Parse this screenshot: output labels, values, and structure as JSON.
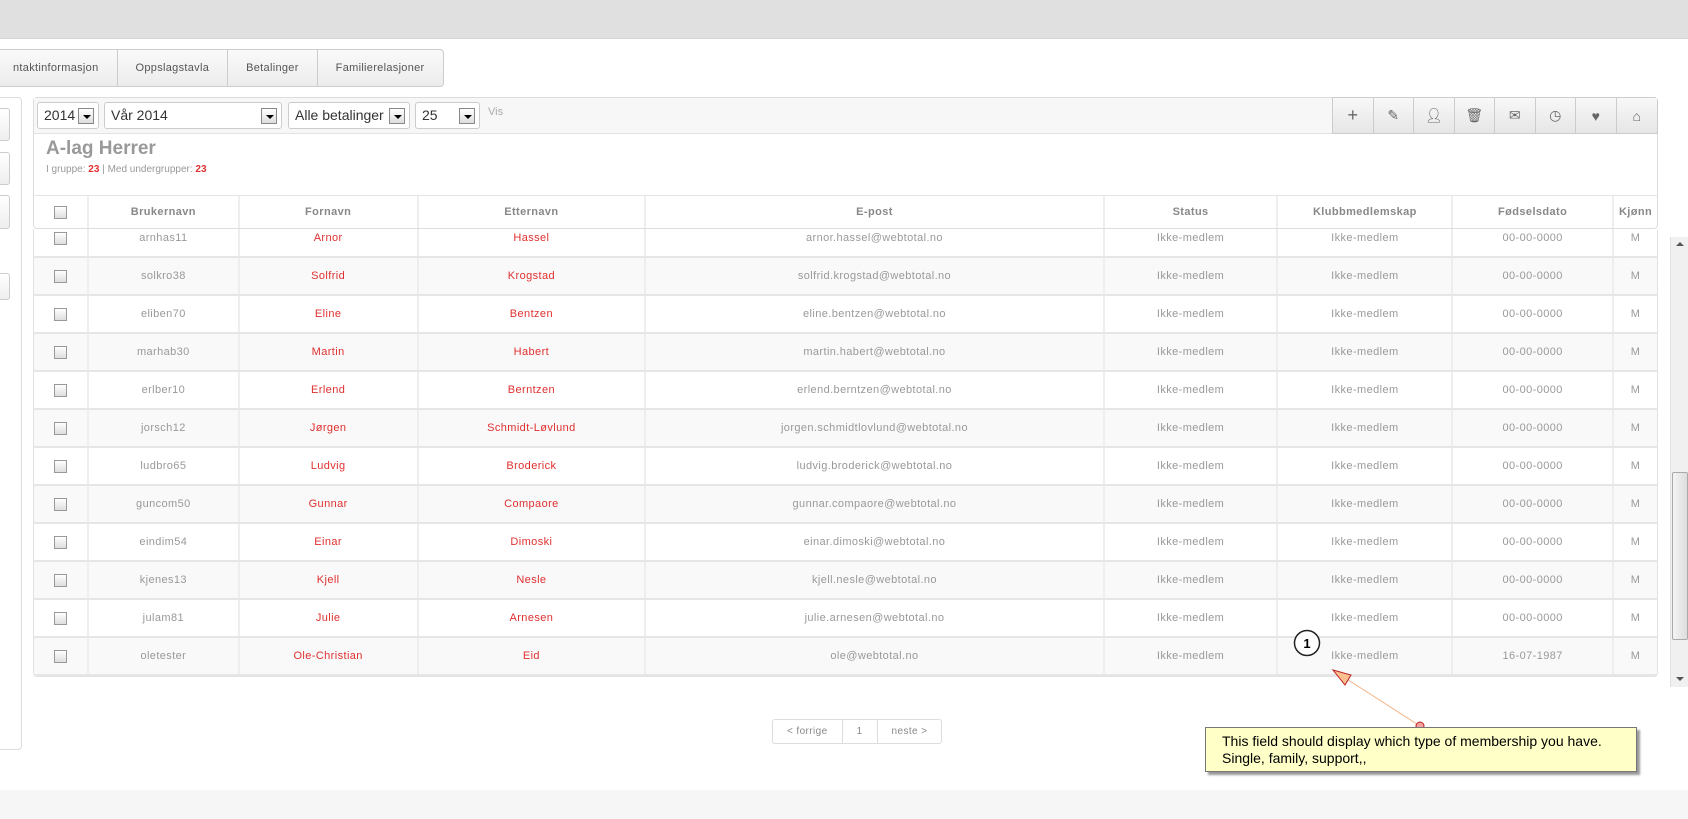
{
  "tabs": [
    "ntaktinformasjon",
    "Oppslagstavla",
    "Betalinger",
    "Familierelasjoner"
  ],
  "filters": {
    "year": "2014",
    "term": "Vår 2014",
    "payments": "Alle betalinger",
    "per_page": "25",
    "show_label": "Vis"
  },
  "toolbar_icons": [
    "plus-icon",
    "pencil-icon",
    "user-icon",
    "trash-icon",
    "mail-icon",
    "clock-icon",
    "heart-icon",
    "home-icon"
  ],
  "group": {
    "title": "A-lag Herrer",
    "in_group_label": "I gruppe:",
    "in_group_count": "23",
    "sep": "|",
    "sub_label": "Med undergrupper:",
    "sub_count": "23"
  },
  "columns": [
    "Brukernavn",
    "Fornavn",
    "Etternavn",
    "E-post",
    "Status",
    "Klubbmedlemskap",
    "Fødselsdato",
    "Kjønn"
  ],
  "rows": [
    [
      "arnhas11",
      "Arnor",
      "Hassel",
      "arnor.hassel@webtotal.no",
      "Ikke-medlem",
      "Ikke-medlem",
      "00-00-0000",
      "M"
    ],
    [
      "solkro38",
      "Solfrid",
      "Krogstad",
      "solfrid.krogstad@webtotal.no",
      "Ikke-medlem",
      "Ikke-medlem",
      "00-00-0000",
      "M"
    ],
    [
      "eliben70",
      "Eline",
      "Bentzen",
      "eline.bentzen@webtotal.no",
      "Ikke-medlem",
      "Ikke-medlem",
      "00-00-0000",
      "M"
    ],
    [
      "marhab30",
      "Martin",
      "Habert",
      "martin.habert@webtotal.no",
      "Ikke-medlem",
      "Ikke-medlem",
      "00-00-0000",
      "M"
    ],
    [
      "erlber10",
      "Erlend",
      "Berntzen",
      "erlend.berntzen@webtotal.no",
      "Ikke-medlem",
      "Ikke-medlem",
      "00-00-0000",
      "M"
    ],
    [
      "jorsch12",
      "Jørgen",
      "Schmidt-Løvlund",
      "jorgen.schmidtlovlund@webtotal.no",
      "Ikke-medlem",
      "Ikke-medlem",
      "00-00-0000",
      "M"
    ],
    [
      "ludbro65",
      "Ludvig",
      "Broderick",
      "ludvig.broderick@webtotal.no",
      "Ikke-medlem",
      "Ikke-medlem",
      "00-00-0000",
      "M"
    ],
    [
      "guncom50",
      "Gunnar",
      "Compaore",
      "gunnar.compaore@webtotal.no",
      "Ikke-medlem",
      "Ikke-medlem",
      "00-00-0000",
      "M"
    ],
    [
      "eindim54",
      "Einar",
      "Dimoski",
      "einar.dimoski@webtotal.no",
      "Ikke-medlem",
      "Ikke-medlem",
      "00-00-0000",
      "M"
    ],
    [
      "kjenes13",
      "Kjell",
      "Nesle",
      "kjell.nesle@webtotal.no",
      "Ikke-medlem",
      "Ikke-medlem",
      "00-00-0000",
      "M"
    ],
    [
      "julam81",
      "Julie",
      "Arnesen",
      "julie.arnesen@webtotal.no",
      "Ikke-medlem",
      "Ikke-medlem",
      "00-00-0000",
      "M"
    ],
    [
      "oletester",
      "Ole-Christian",
      "Eid",
      "ole@webtotal.no",
      "Ikke-medlem",
      "Ikke-medlem",
      "16-07-1987",
      "M"
    ]
  ],
  "pagination": {
    "prev": "< forrige",
    "page": "1",
    "next": "neste >"
  },
  "annotation": {
    "number": "1",
    "text_line1": "This field should display which type of membership you have.",
    "text_line2": "Single, family, support,,"
  },
  "colors": {
    "accent_red": "#e03030",
    "note_bg": "#ffffc8"
  }
}
